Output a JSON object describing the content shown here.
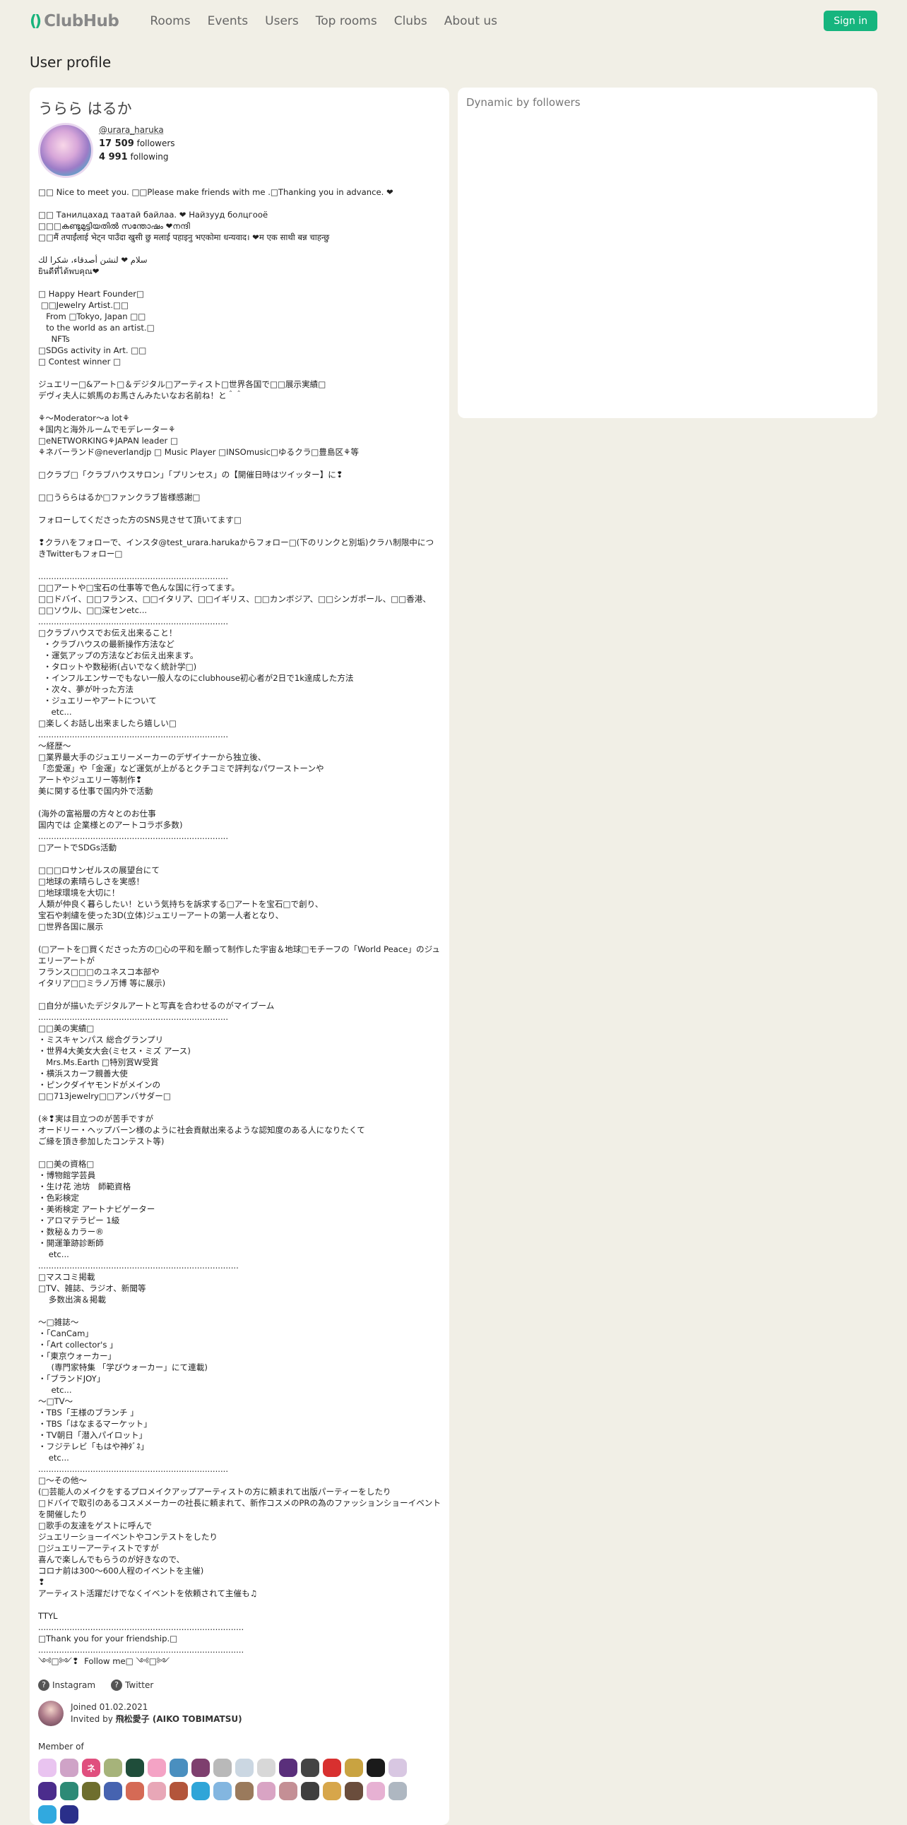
{
  "app": {
    "logo_mark": "()",
    "logo_text": "ClubHub",
    "signin_label": "Sign in"
  },
  "nav": {
    "items": [
      "Rooms",
      "Events",
      "Users",
      "Top rooms",
      "Clubs",
      "About us"
    ]
  },
  "page": {
    "title": "User profile"
  },
  "profile": {
    "name": "うらら はるか",
    "username": "@urara_haruka",
    "followers": "17 509",
    "followers_label": "followers",
    "following": "4 991",
    "following_label": "following",
    "bio": "□□ Nice to meet you. □□Please make friends with me .□Thanking you in advance. ❤\n\n□□ Танилцахад таатай байлаа. ❤ Найзууд болцгооё\n□□□കണ്ടുമുട്ടിയതിൽ സന്തോഷം ❤നന്ദി\n□□मैं तपाईंलाई भेट्न पाउँदा खुसी छु मलाई पहाइनु भएकोमा धन्यवाद। ❤म एक साथी बन्न चाहन्छु\n\nسلام ❤ لنشن أصدقاء، شكرا لك\nยินดีที่ได้พบคุณ❤\n\n□ Happy Heart Founder□\n □□Jewelry Artist.□□\n   From □Tokyo, Japan □□\n   to the world as an artist.□\n     NFTs\n□SDGs activity in Art. □□\n□ Contest winner □\n\nジュエリー□&アート□＆デジタル□アーティスト□世界各国で□□展示実績□\nデヴィ夫人に娯馬のお馬さんみたいなお名前ね！と＾＾\n\n⚘〜Moderator〜a lot⚘\n⚘国内と海外ルームでモデレーター⚘\n□eNETWORKING⚘JAPAN leader □\n⚘ネバーランド@neverlandjp □ Music Player □INSOmusic□ゆるクラ□豊島区⚘等\n\n□クラブ□「クラブハウスサロン」「プリンセス」の【開催日時はツイッター】に❢\n\n□□うららはるか□ファンクラブ皆様感謝□\n\nフォローしてくださった方のSNS見させて頂いてます□\n\n❢クラハをフォローで、インスタ@test_urara.harukaからフォロー□(下のリンクと別垢)クラハ制限中につきTwitterもフォロー□\n\n.........................................................................\n□□アートや□宝石の仕事等で色んな国に行ってます。\n□□ドバイ、□□フランス、□□イタリア、□□イギリス、□□カンボジア、□□シンガポール、□□香港、□□ソウル、□□深センetc...\n.........................................................................\n□クラブハウスでお伝え出来ること！\n  ・クラブハウスの最新操作方法など\n  ・運気アップの方法などお伝え出来ます。\n  ・タロットや数秘術(占いでなく統計学□)\n  ・インフルエンサーでもない一般人なのにclubhouse初心者が2日で1k達成した方法\n  ・次々、夢が叶った方法\n  ・ジュエリーやアートについて\n     etc...\n□楽しくお話し出来ましたら嬉しい□\n.........................................................................\n〜経歴〜\n□業界最大手のジュエリーメーカーのデザイナーから独立後、\n「恋愛運」や「金運」など運気が上がるとクチコミで評判なパワーストーンや\nアートやジュエリー等制作❢\n美に関する仕事で国内外で活動\n\n(海外の富裕層の方々とのお仕事\n国内では 企業様とのアートコラボ多数)\n.........................................................................\n□アートでSDGs活動\n\n□□□ロサンゼルスの展望台にて\n□地球の素晴らしさを実感！\n□地球環境を大切に！\n人類が仲良く暮らしたい！という気持ちを訴求する□アートを宝石□で創り、\n宝石や刺繍を使った3D(立体)ジュエリーアートの第一人者となり、\n□世界各国に展示\n\n(□アートを□買くださった方の□心の平和を願って制作した宇宙＆地球□モチーフの「World Peace」のジュエリーアートが\nフランス□□□のユネスコ本部や\nイタリア□□ミラノ万博 等に展示)\n\n□自分が描いたデジタルアートと写真を合わせるのがマイブーム\n.........................................................................\n□□美の実績□\n・ミスキャンパス 総合グランプリ\n・世界4大美女大会(ミセス・ミズ アース)\n   Mrs.Ms.Earth □特別賞W受賞\n・横浜スカーフ親善大使\n・ピンクダイヤモンドがメインの\n□□713jewelry□□アンバサダー□\n\n(※❢実は目立つのが苦手ですが\nオードリー・ヘップバーン様のように社会貢献出来るような認知度のある人になりたくて\nご縁を頂き参加したコンテスト等)\n\n□□美の資格□\n・博物館学芸員\n・生け花 池坊　師範資格\n・色彩検定\n・美術検定 アートナビゲーター\n・アロマテラピー 1級\n・数秘＆カラー®\n・開運筆跡診断師\n    etc...\n.............................................................................\n□マスコミ掲載\n□TV、雑誌、ラジオ、新聞等\n    多数出演＆掲載\n\n〜□雑誌〜\n・「CanCam」\n・「Art collector's 」\n・「東京ウォーカー」\n     (専門家特集 「学びウォーカー」にて連載)\n・「ブランドJOY」\n     etc...\n〜□TV〜\n・TBS「王様のブランチ 」\n・TBS「はなまるマーケット」\n・TV朝日「潜入パイロット」\n・フジテレビ「もはや神ﾀﾞﾈ」\n    etc...\n.........................................................................\n□〜その他〜\n(□芸能人のメイクをするプロメイクアップアーティストの方に頼まれて出版パーティーをしたり\n□ドバイで取引のあるコスメメーカーの社長に頼まれて、新作コスメのPRの為のファッションショーイベントを開催したり\n□歌手の友達をゲストに呼んで\nジュエリーショーイベントやコンテストをしたり\n□ジュエリーアーティストですが\n喜んで楽しんでもらうのが好きなので、\nコロナ前は300〜600人程のイベントを主催)\n❢\nアーティスト活躍だけでなくイベントを依頼されて主催も♫\n\nTTYL\n...............................................................................\n□Thank you for your friendship.□\n...............................................................................\n༺□༻❢  Follow me□ ༺□༻",
    "social": [
      {
        "icon": "question-icon",
        "label": "Instagram"
      },
      {
        "icon": "question-icon",
        "label": "Twitter"
      }
    ],
    "joined_text": "Joined 01.02.2021",
    "invited_prefix": "Invited by",
    "invited_by": "飛松愛子 (AIKO TOBIMATSU)",
    "member_of_label": "Member of",
    "clubs": [
      {
        "label": "",
        "color": "#e9c4f0"
      },
      {
        "label": "",
        "color": "#cfa3c7"
      },
      {
        "label": "ネ",
        "color": "#e04f7e"
      },
      {
        "label": "",
        "color": "#a6b37a"
      },
      {
        "label": "",
        "color": "#1f4d3a"
      },
      {
        "label": "",
        "color": "#f4a3c5"
      },
      {
        "label": "",
        "color": "#4a8fbf"
      },
      {
        "label": "",
        "color": "#7e3f6e"
      },
      {
        "label": "",
        "color": "#b9b9b9"
      },
      {
        "label": "",
        "color": "#cbd7e2"
      },
      {
        "label": "",
        "color": "#d8d8d8"
      },
      {
        "label": "",
        "color": "#5a2f7b"
      },
      {
        "label": "",
        "color": "#444444"
      },
      {
        "label": "",
        "color": "#d8302f"
      },
      {
        "label": "",
        "color": "#c9a341"
      },
      {
        "label": "",
        "color": "#1a1a1a"
      },
      {
        "label": "",
        "color": "#d8c7e2"
      },
      {
        "label": "",
        "color": "#4b2c8c"
      },
      {
        "label": "",
        "color": "#2d8a76"
      },
      {
        "label": "",
        "color": "#6e6e2e"
      },
      {
        "label": "",
        "color": "#4663b0"
      },
      {
        "label": "",
        "color": "#d56a55"
      },
      {
        "label": "",
        "color": "#e8a7b7"
      },
      {
        "label": "",
        "color": "#b3553b"
      },
      {
        "label": "",
        "color": "#2fa5d8"
      },
      {
        "label": "",
        "color": "#83b6e0"
      },
      {
        "label": "",
        "color": "#9a7a5c"
      },
      {
        "label": "",
        "color": "#d9a4c4"
      },
      {
        "label": "",
        "color": "#c48f95"
      },
      {
        "label": "",
        "color": "#3f3f3f"
      },
      {
        "label": "",
        "color": "#d7a64a"
      },
      {
        "label": "",
        "color": "#6a4d3c"
      },
      {
        "label": "",
        "color": "#e7b1d3"
      },
      {
        "label": "",
        "color": "#aeb7c1"
      },
      {
        "label": "",
        "color": "#31a9df"
      },
      {
        "label": "",
        "color": "#2a2f8a"
      }
    ]
  }
}
